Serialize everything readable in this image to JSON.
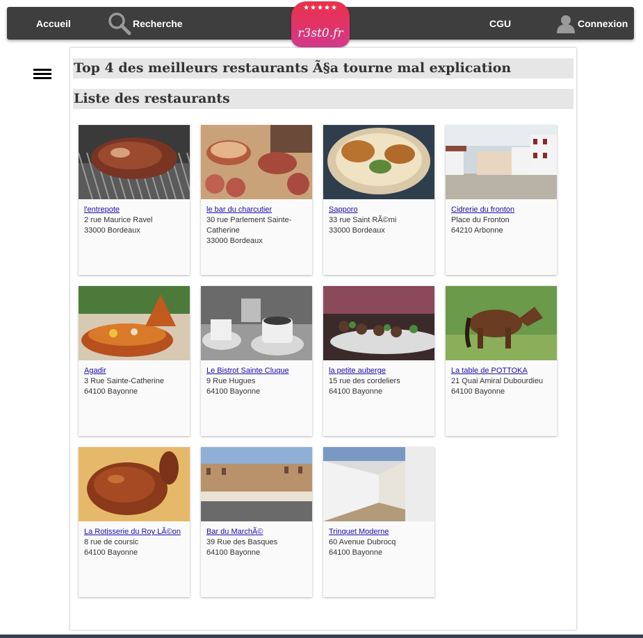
{
  "nav": {
    "home": "Accueil",
    "search": "Recherche",
    "cgu": "CGU",
    "login": "Connexion"
  },
  "logo": {
    "stars": "★★★★★",
    "text": "r3st0.fr"
  },
  "page": {
    "top_heading": "Top 4 des meilleurs restaurants Ã§a tourne mal explication",
    "list_heading": "Liste des restaurants"
  },
  "restaurants": [
    {
      "name": "l'entrepote",
      "address": "2 rue Maurice Ravel",
      "address2": "",
      "city": "33000 Bordeaux"
    },
    {
      "name": "le bar du charcutier",
      "address": "30 rue Parlement Sainte-",
      "address2": "Catherine",
      "city": "33000 Bordeaux"
    },
    {
      "name": "Sapporo",
      "address": "33 rue Saint RÃ©mi",
      "address2": "",
      "city": "33000 Bordeaux"
    },
    {
      "name": "Cidrerie du fronton",
      "address": "Place du Fronton",
      "address2": "",
      "city": "64210 Arbonne"
    },
    {
      "name": "Agadir",
      "address": "3 Rue Sainte-Catherine",
      "address2": "",
      "city": "64100 Bayonne"
    },
    {
      "name": "Le Bistrot Sainte Cluque",
      "address": "9 Rue Hugues",
      "address2": "",
      "city": "64100 Bayonne"
    },
    {
      "name": "la petite auberge",
      "address": "15 rue des cordeliers",
      "address2": "",
      "city": "64100 Bayonne"
    },
    {
      "name": "La table de POTTOKA",
      "address": "21 Quai Amiral Dubourdieu",
      "address2": "",
      "city": "64100 Bayonne"
    },
    {
      "name": "La Rotisserie du Roy LÃ©on",
      "address": "8 rue de coursic",
      "address2": "",
      "city": "64100 Bayonne"
    },
    {
      "name": "Bar du MarchÃ©",
      "address": "39 Rue des Basques",
      "address2": "",
      "city": "64100 Bayonne"
    },
    {
      "name": "Trinquet Moderne",
      "address": "60 Avenue Dubrocq",
      "address2": "",
      "city": "64100 Bayonne"
    }
  ],
  "photos": [
    {
      "subject": "grilled-steak-photo"
    },
    {
      "subject": "charcuterie-photo"
    },
    {
      "subject": "donburi-bowl-photo"
    },
    {
      "subject": "fronton-building-photo"
    },
    {
      "subject": "tajine-photo"
    },
    {
      "subject": "coffee-cups-photo"
    },
    {
      "subject": "skewers-photo"
    },
    {
      "subject": "pony-photo"
    },
    {
      "subject": "roast-chicken-photo"
    },
    {
      "subject": "market-square-photo"
    },
    {
      "subject": "trinquet-court-photo"
    }
  ]
}
